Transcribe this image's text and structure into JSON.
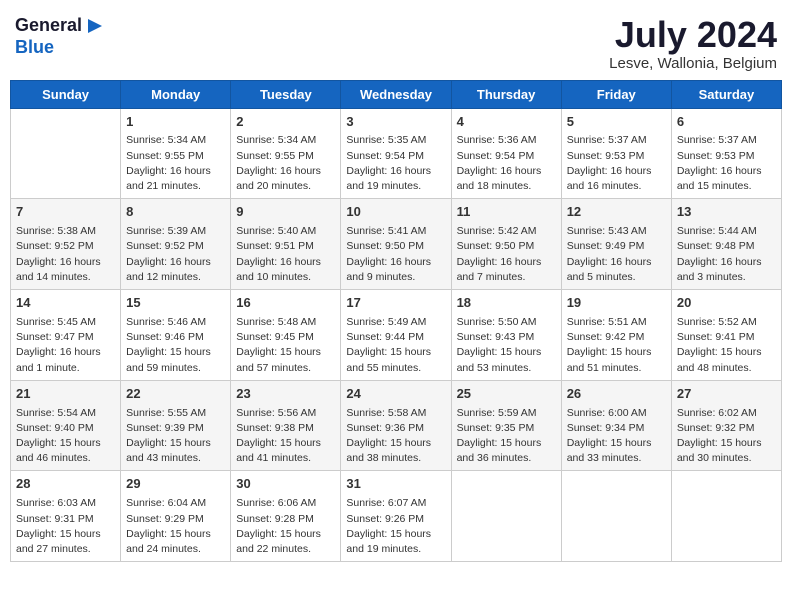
{
  "logo": {
    "line1": "General",
    "line2": "Blue"
  },
  "title": "July 2024",
  "location": "Lesve, Wallonia, Belgium",
  "days_of_week": [
    "Sunday",
    "Monday",
    "Tuesday",
    "Wednesday",
    "Thursday",
    "Friday",
    "Saturday"
  ],
  "weeks": [
    [
      {
        "day": "",
        "content": ""
      },
      {
        "day": "1",
        "content": "Sunrise: 5:34 AM\nSunset: 9:55 PM\nDaylight: 16 hours\nand 21 minutes."
      },
      {
        "day": "2",
        "content": "Sunrise: 5:34 AM\nSunset: 9:55 PM\nDaylight: 16 hours\nand 20 minutes."
      },
      {
        "day": "3",
        "content": "Sunrise: 5:35 AM\nSunset: 9:54 PM\nDaylight: 16 hours\nand 19 minutes."
      },
      {
        "day": "4",
        "content": "Sunrise: 5:36 AM\nSunset: 9:54 PM\nDaylight: 16 hours\nand 18 minutes."
      },
      {
        "day": "5",
        "content": "Sunrise: 5:37 AM\nSunset: 9:53 PM\nDaylight: 16 hours\nand 16 minutes."
      },
      {
        "day": "6",
        "content": "Sunrise: 5:37 AM\nSunset: 9:53 PM\nDaylight: 16 hours\nand 15 minutes."
      }
    ],
    [
      {
        "day": "7",
        "content": "Sunrise: 5:38 AM\nSunset: 9:52 PM\nDaylight: 16 hours\nand 14 minutes."
      },
      {
        "day": "8",
        "content": "Sunrise: 5:39 AM\nSunset: 9:52 PM\nDaylight: 16 hours\nand 12 minutes."
      },
      {
        "day": "9",
        "content": "Sunrise: 5:40 AM\nSunset: 9:51 PM\nDaylight: 16 hours\nand 10 minutes."
      },
      {
        "day": "10",
        "content": "Sunrise: 5:41 AM\nSunset: 9:50 PM\nDaylight: 16 hours\nand 9 minutes."
      },
      {
        "day": "11",
        "content": "Sunrise: 5:42 AM\nSunset: 9:50 PM\nDaylight: 16 hours\nand 7 minutes."
      },
      {
        "day": "12",
        "content": "Sunrise: 5:43 AM\nSunset: 9:49 PM\nDaylight: 16 hours\nand 5 minutes."
      },
      {
        "day": "13",
        "content": "Sunrise: 5:44 AM\nSunset: 9:48 PM\nDaylight: 16 hours\nand 3 minutes."
      }
    ],
    [
      {
        "day": "14",
        "content": "Sunrise: 5:45 AM\nSunset: 9:47 PM\nDaylight: 16 hours\nand 1 minute."
      },
      {
        "day": "15",
        "content": "Sunrise: 5:46 AM\nSunset: 9:46 PM\nDaylight: 15 hours\nand 59 minutes."
      },
      {
        "day": "16",
        "content": "Sunrise: 5:48 AM\nSunset: 9:45 PM\nDaylight: 15 hours\nand 57 minutes."
      },
      {
        "day": "17",
        "content": "Sunrise: 5:49 AM\nSunset: 9:44 PM\nDaylight: 15 hours\nand 55 minutes."
      },
      {
        "day": "18",
        "content": "Sunrise: 5:50 AM\nSunset: 9:43 PM\nDaylight: 15 hours\nand 53 minutes."
      },
      {
        "day": "19",
        "content": "Sunrise: 5:51 AM\nSunset: 9:42 PM\nDaylight: 15 hours\nand 51 minutes."
      },
      {
        "day": "20",
        "content": "Sunrise: 5:52 AM\nSunset: 9:41 PM\nDaylight: 15 hours\nand 48 minutes."
      }
    ],
    [
      {
        "day": "21",
        "content": "Sunrise: 5:54 AM\nSunset: 9:40 PM\nDaylight: 15 hours\nand 46 minutes."
      },
      {
        "day": "22",
        "content": "Sunrise: 5:55 AM\nSunset: 9:39 PM\nDaylight: 15 hours\nand 43 minutes."
      },
      {
        "day": "23",
        "content": "Sunrise: 5:56 AM\nSunset: 9:38 PM\nDaylight: 15 hours\nand 41 minutes."
      },
      {
        "day": "24",
        "content": "Sunrise: 5:58 AM\nSunset: 9:36 PM\nDaylight: 15 hours\nand 38 minutes."
      },
      {
        "day": "25",
        "content": "Sunrise: 5:59 AM\nSunset: 9:35 PM\nDaylight: 15 hours\nand 36 minutes."
      },
      {
        "day": "26",
        "content": "Sunrise: 6:00 AM\nSunset: 9:34 PM\nDaylight: 15 hours\nand 33 minutes."
      },
      {
        "day": "27",
        "content": "Sunrise: 6:02 AM\nSunset: 9:32 PM\nDaylight: 15 hours\nand 30 minutes."
      }
    ],
    [
      {
        "day": "28",
        "content": "Sunrise: 6:03 AM\nSunset: 9:31 PM\nDaylight: 15 hours\nand 27 minutes."
      },
      {
        "day": "29",
        "content": "Sunrise: 6:04 AM\nSunset: 9:29 PM\nDaylight: 15 hours\nand 24 minutes."
      },
      {
        "day": "30",
        "content": "Sunrise: 6:06 AM\nSunset: 9:28 PM\nDaylight: 15 hours\nand 22 minutes."
      },
      {
        "day": "31",
        "content": "Sunrise: 6:07 AM\nSunset: 9:26 PM\nDaylight: 15 hours\nand 19 minutes."
      },
      {
        "day": "",
        "content": ""
      },
      {
        "day": "",
        "content": ""
      },
      {
        "day": "",
        "content": ""
      }
    ]
  ]
}
